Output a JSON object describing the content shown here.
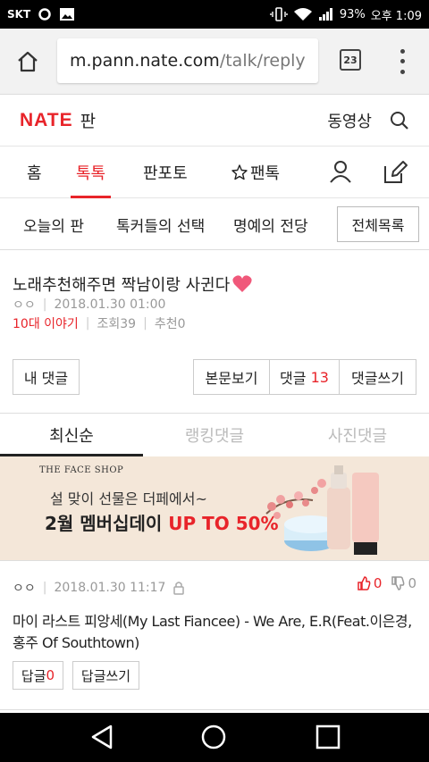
{
  "status_bar": {
    "carrier": "SKT",
    "battery": "93%",
    "time": "오후 1:09"
  },
  "browser": {
    "url_host": "m.pann.nate.com",
    "url_path": "/talk/reply",
    "tab_count": "23"
  },
  "site": {
    "logo": "NATE",
    "section": "판",
    "video_label": "동영상"
  },
  "main_nav": {
    "items": [
      "홈",
      "톡톡",
      "판포토",
      "팬톡"
    ],
    "active": "톡톡"
  },
  "sub_nav": {
    "items": [
      "오늘의 판",
      "톡커들의 선택",
      "명예의 전당"
    ],
    "all_list": "전체목록"
  },
  "post": {
    "title": "노래추천해주면 짝남이랑 사귄다",
    "author": "ㅇㅇ",
    "date": "2018.01.30 01:00",
    "category": "10대 이야기",
    "views": "조회39",
    "recommends": "추천0"
  },
  "buttons": {
    "my_comments": "내 댓글",
    "view_body": "본문보기",
    "comments_label": "댓글",
    "comments_count": "13",
    "write_comment": "댓글쓰기"
  },
  "comment_tabs": [
    "최신순",
    "랭킹댓글",
    "사진댓글"
  ],
  "banner": {
    "brand": "THE FACE SHOP",
    "line1": "설 맞이 선물은 더페에서~",
    "line2_main": "2월 멤버십데이 ",
    "line2_accent": "UP TO 50%"
  },
  "comment": {
    "author": "ㅇㅇ",
    "date": "2018.01.30 11:17",
    "up_votes": "0",
    "down_votes": "0",
    "text": "마이 라스트 피앙세(My Last Fiancee) - We Are, E.R(Feat.이은경,홍주 Of Southtown)",
    "reply_label": "답글",
    "reply_count": "0",
    "write_reply": "답글쓰기"
  },
  "colors": {
    "brand_red": "#e8242a",
    "banner_bg": "#f4e7d9"
  }
}
